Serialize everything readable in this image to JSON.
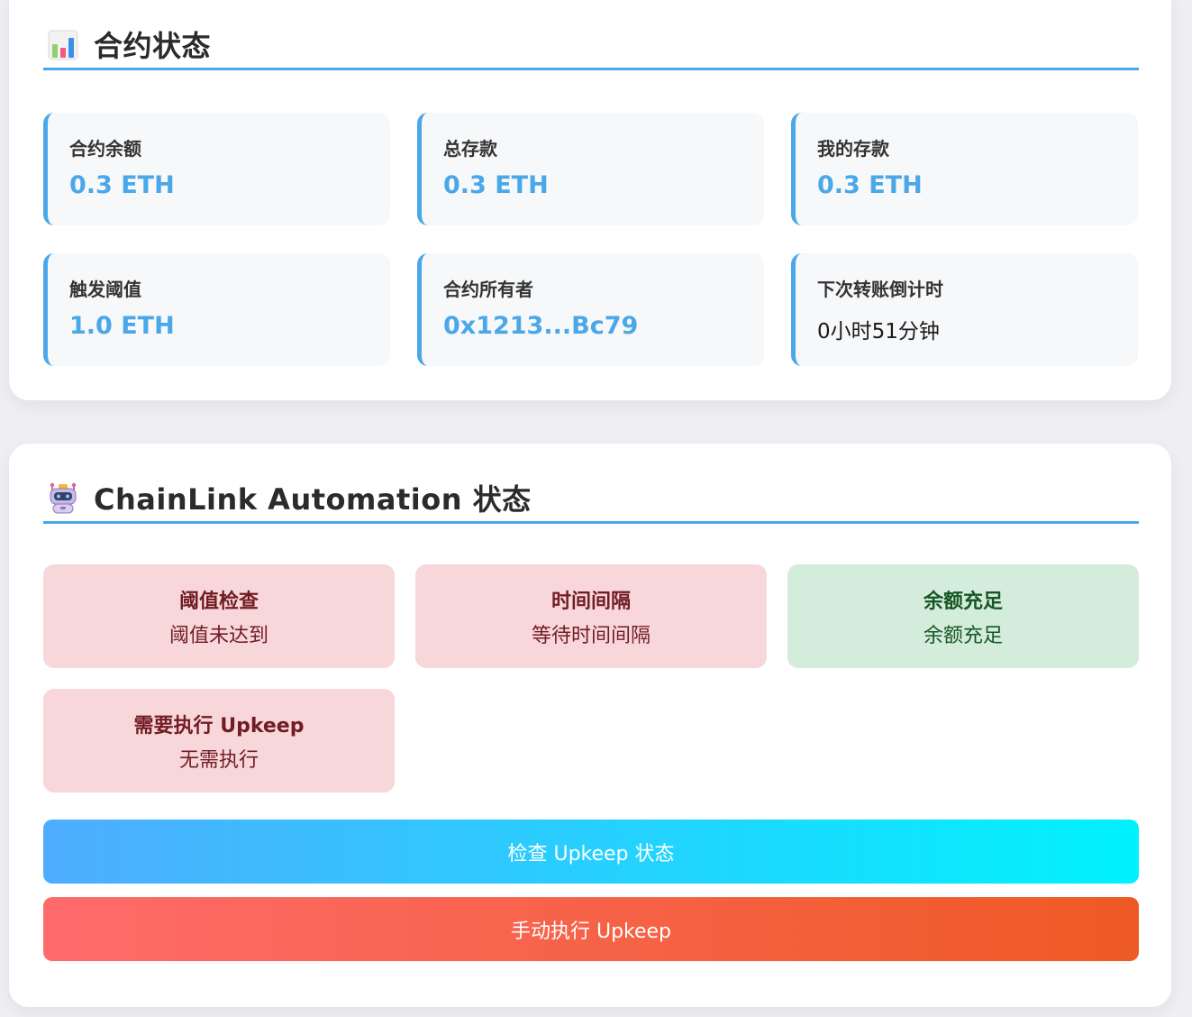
{
  "contract_status": {
    "title": "合约状态",
    "icon": "bar-chart-icon",
    "stats": [
      {
        "label": "合约余额",
        "value": "0.3 ETH"
      },
      {
        "label": "总存款",
        "value": "0.3 ETH"
      },
      {
        "label": "我的存款",
        "value": "0.3 ETH"
      },
      {
        "label": "触发阈值",
        "value": "1.0 ETH"
      },
      {
        "label": "合约所有者",
        "value": "0x1213...Bc79"
      },
      {
        "label": "下次转账倒计时",
        "value": "0小时51分钟"
      }
    ]
  },
  "automation": {
    "title": "ChainLink Automation 状态",
    "icon": "robot-icon",
    "checks": [
      {
        "title": "阈值检查",
        "status": "阈值未达到",
        "state": "fail"
      },
      {
        "title": "时间间隔",
        "status": "等待时间间隔",
        "state": "fail"
      },
      {
        "title": "余额充足",
        "status": "余额充足",
        "state": "pass"
      },
      {
        "title": "需要执行 Upkeep",
        "status": "无需执行",
        "state": "fail"
      }
    ],
    "check_button_label": "检查 Upkeep 状态",
    "manual_button_label": "手动执行 Upkeep"
  },
  "colors": {
    "accent": "#4aa8e8",
    "fail_bg": "#f7d7da",
    "fail_text": "#721c24",
    "pass_bg": "#d4ecdb",
    "pass_text": "#155724"
  }
}
